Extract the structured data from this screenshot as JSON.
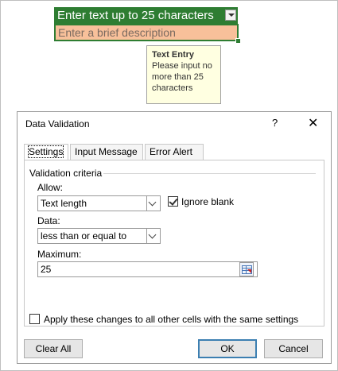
{
  "sheet": {
    "header_cell": "Enter text up to 25 characters",
    "input_cell": "Enter a brief description",
    "tooltip": {
      "title": "Text Entry",
      "body": "Please input no more than 25 characters"
    },
    "colors": {
      "header_bg": "#2e7d32",
      "input_bg": "#f8c09a",
      "tooltip_bg": "#ffffe1"
    }
  },
  "dialog": {
    "title": "Data Validation",
    "help": "?",
    "close": "✕",
    "tabs": [
      "Settings",
      "Input Message",
      "Error Alert"
    ],
    "active_tab": "Settings",
    "validation_criteria": "Validation criteria",
    "allow_label": "Allow:",
    "allow_value": "Text length",
    "ignore_blank_label": "Ignore blank",
    "ignore_blank_checked": true,
    "data_label": "Data:",
    "data_value": "less than or equal to",
    "maximum_label": "Maximum:",
    "maximum_value": "25",
    "apply_all_label": "Apply these changes to all other cells with the same settings",
    "apply_all_checked": false,
    "buttons": {
      "clear_all": "Clear All",
      "ok": "OK",
      "cancel": "Cancel"
    },
    "accent_color": "#3c7fb1"
  }
}
